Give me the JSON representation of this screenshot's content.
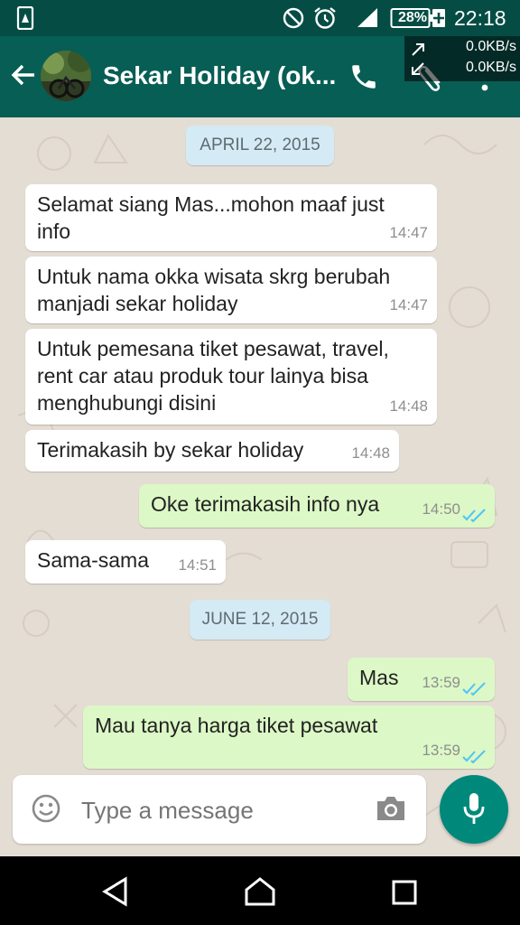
{
  "status_bar": {
    "battery": "28%",
    "time": "22:18",
    "network_up": "0.0KB/s",
    "network_down": "0.0KB/s",
    "icons": [
      "phone-storage-icon",
      "do-not-disturb-icon",
      "alarm-icon",
      "signal-icon",
      "battery-icon",
      "charging-icon"
    ]
  },
  "header": {
    "contact_name": "Sekar Holiday (ok...",
    "icons": [
      "back-arrow-icon",
      "avatar",
      "phone-icon",
      "attach-icon",
      "more-icon"
    ]
  },
  "colors": {
    "header": "#075e54",
    "status_bar": "#054d44",
    "outgoing_bubble": "#dcf8c6",
    "incoming_bubble": "#ffffff",
    "read_ticks": "#4fc3f7",
    "fab": "#00897b"
  },
  "messages": [
    {
      "type": "date",
      "text": "APRIL 22, 2015"
    },
    {
      "type": "in",
      "lines": [
        "Selamat siang Mas...mohon maaf just",
        "info"
      ],
      "time": "14:47"
    },
    {
      "type": "in",
      "lines": [
        "Untuk nama okka wisata skrg berubah",
        "manjadi sekar holiday"
      ],
      "time": "14:47"
    },
    {
      "type": "in",
      "lines": [
        "Untuk pemesana tiket pesawat, travel,",
        "rent car atau produk tour lainya bisa",
        "menghubungi disini"
      ],
      "time": "14:48"
    },
    {
      "type": "in",
      "lines": [
        "Terimakasih by sekar holiday"
      ],
      "time": "14:48"
    },
    {
      "type": "out",
      "lines": [
        "Oke terimakasih info nya"
      ],
      "time": "14:50",
      "status": "read"
    },
    {
      "type": "in",
      "lines": [
        "Sama-sama"
      ],
      "time": "14:51"
    },
    {
      "type": "date",
      "text": "JUNE 12, 2015"
    },
    {
      "type": "out",
      "lines": [
        "Mas"
      ],
      "time": "13:59",
      "status": "read"
    },
    {
      "type": "out",
      "lines": [
        "Mau tanya harga tiket pesawat"
      ],
      "time": "13:59",
      "status": "read"
    }
  ],
  "composer": {
    "placeholder": "Type a message",
    "icons": [
      "emoji-icon",
      "camera-icon",
      "mic-icon"
    ]
  },
  "nav_bar": {
    "icons": [
      "back-nav-icon",
      "home-nav-icon",
      "recents-nav-icon"
    ]
  }
}
